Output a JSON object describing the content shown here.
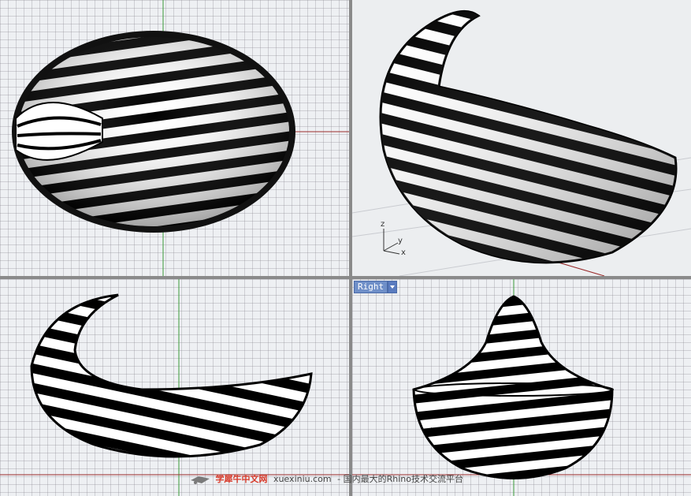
{
  "viewports": {
    "top": {
      "name": ""
    },
    "perspective": {
      "name": ""
    },
    "front": {
      "name": ""
    },
    "right": {
      "name": "Right"
    }
  },
  "axes": {
    "z": "z",
    "y": "y",
    "x": "x"
  },
  "watermark": {
    "brand": "学犀牛中文网",
    "url": "xuexiniu.com",
    "slogan": "- 国内最大的Rhino技术交流平台"
  },
  "colors": {
    "x_axis": "#9a2b2b",
    "y_axis": "#3a9a3a",
    "viewport_tab": "#6f8fc8",
    "zebra_dark": "#000000",
    "zebra_light": "#ffffff"
  },
  "icons": [
    "viewport-menu-chevron-icon",
    "axis-triad-icon",
    "watermark-logo-icon"
  ]
}
